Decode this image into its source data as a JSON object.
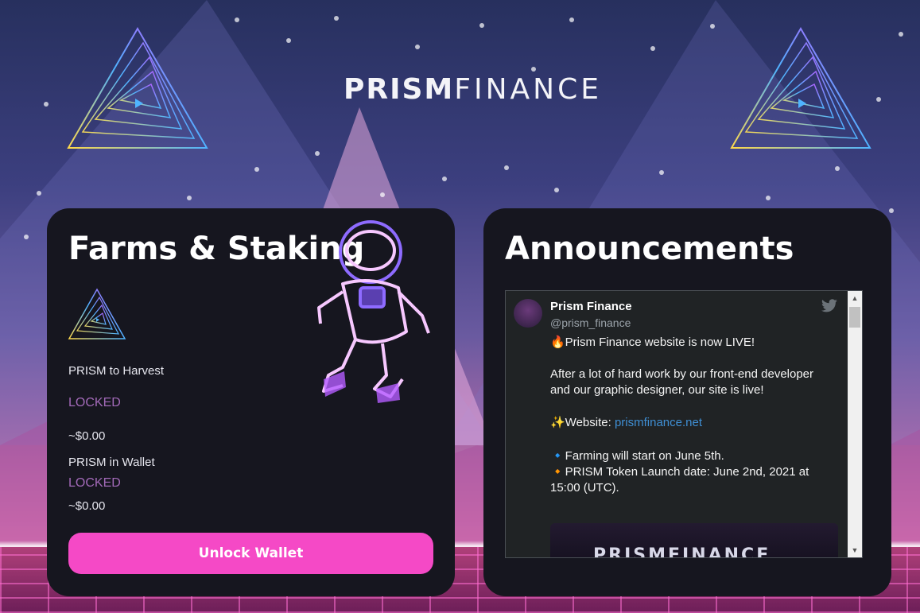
{
  "header": {
    "logo_bold": "PRISM",
    "logo_light": "FINANCE"
  },
  "farms": {
    "title": "Farms & Staking",
    "harvest_label": "PRISM to Harvest",
    "harvest_status": "LOCKED",
    "harvest_usd": "~$0.00",
    "wallet_label": "PRISM in Wallet",
    "wallet_status": "LOCKED",
    "wallet_usd": "~$0.00",
    "unlock_button": "Unlock Wallet"
  },
  "announcements": {
    "title": "Announcements",
    "tweet": {
      "name": "Prism Finance",
      "handle": "@prism_finance",
      "line1": "🔥Prism Finance website is now LIVE!",
      "line2": "After a lot of hard work by our front-end developer and our graphic designer, our site is live!",
      "website_prefix": "✨Website: ",
      "website_link": "prismfinance.net",
      "line4": "🔹Farming will start on June 5th.",
      "line5": "🔸PRISM Token Launch date: June 2nd, 2021 at 15:00 (UTC).",
      "media_text": "PRISMFINANCE"
    }
  },
  "colors": {
    "card_bg": "#16161f",
    "accent_pink": "#f549c6",
    "locked_purple": "#a36ab9",
    "link_blue": "#3f8fd4"
  },
  "icons": {
    "twitter": "twitter-bird-icon",
    "token": "prism-triangle-icon",
    "scroll_up": "chevron-up-icon",
    "scroll_down": "chevron-down-icon"
  }
}
